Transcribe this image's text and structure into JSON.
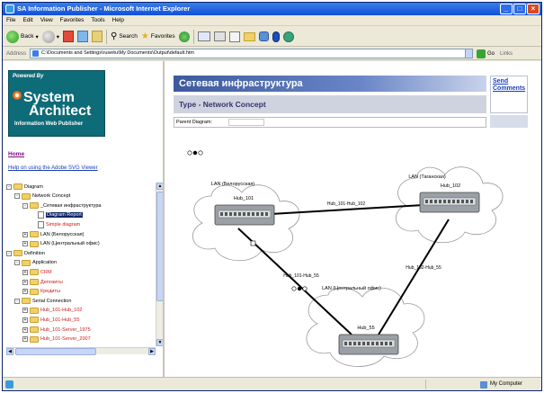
{
  "window": {
    "title": "SA Information Publisher - Microsoft Internet Explorer"
  },
  "menu": [
    "File",
    "Edit",
    "View",
    "Favorites",
    "Tools",
    "Help"
  ],
  "toolbar": {
    "back_label": "Back",
    "search_label": "Search",
    "favorites_label": "Favorites"
  },
  "address": {
    "label": "Address",
    "value": "C:\\Documents and Settings\\ruseitu\\My Documents\\Output\\default.htm",
    "go_label": "Go",
    "links_label": "Links"
  },
  "left": {
    "logo": {
      "powered": "Powered By",
      "line1": "System",
      "line2": "Architect",
      "line3": "Information Web Publisher"
    },
    "home_link": "Home",
    "help_link": "Help on using the Adobe SVG Viewer",
    "tree": [
      {
        "label": "Diagram",
        "level": 0,
        "kind": "folder",
        "exp": "-",
        "color": "normal"
      },
      {
        "label": "Network Concept",
        "level": 1,
        "kind": "folder",
        "exp": "-",
        "color": "normal"
      },
      {
        "label": "_Сетевая инфраструктура",
        "level": 2,
        "kind": "folder",
        "exp": "-",
        "color": "normal"
      },
      {
        "label": "Diagram Report",
        "level": 3,
        "kind": "doc",
        "exp": "",
        "color": "selected"
      },
      {
        "label": "Simple diagram",
        "level": 3,
        "kind": "doc",
        "exp": "",
        "color": "red"
      },
      {
        "label": "LAN (Белорусская)",
        "level": 2,
        "kind": "folder",
        "exp": "+",
        "color": "normal"
      },
      {
        "label": "LAN (Центральный офис)",
        "level": 2,
        "kind": "folder",
        "exp": "+",
        "color": "normal"
      },
      {
        "label": "Definition",
        "level": 0,
        "kind": "folder",
        "exp": "-",
        "color": "normal"
      },
      {
        "label": "Application",
        "level": 1,
        "kind": "folder",
        "exp": "-",
        "color": "normal"
      },
      {
        "label": "CRM",
        "level": 2,
        "kind": "folder",
        "exp": "+",
        "color": "red"
      },
      {
        "label": "Депозиты",
        "level": 2,
        "kind": "folder",
        "exp": "+",
        "color": "red"
      },
      {
        "label": "Кредиты",
        "level": 2,
        "kind": "folder",
        "exp": "+",
        "color": "red"
      },
      {
        "label": "Serial Connection",
        "level": 1,
        "kind": "folder",
        "exp": "-",
        "color": "normal"
      },
      {
        "label": "Hub_101-Hub_102",
        "level": 2,
        "kind": "folder",
        "exp": "+",
        "color": "red"
      },
      {
        "label": "Hub_101-Hub_55",
        "level": 2,
        "kind": "folder",
        "exp": "+",
        "color": "red"
      },
      {
        "label": "Hub_101-Server_1975",
        "level": 2,
        "kind": "folder",
        "exp": "+",
        "color": "red"
      },
      {
        "label": "Hub_101-Server_2007",
        "level": 2,
        "kind": "folder",
        "exp": "+",
        "color": "red"
      }
    ]
  },
  "right": {
    "title": "Сетевая инфраструктура",
    "type_line": "Type - Network Concept",
    "parent_label": "Parent Diagram:",
    "send_comments": "Send Comments"
  },
  "diagram": {
    "clouds": [
      {
        "name": "LAN (Белорусская)",
        "hub": "Hub_101"
      },
      {
        "name": "LAN (Таганская)",
        "hub": "Hub_102"
      },
      {
        "name": "LAN (Центральный офис)",
        "hub": "Hub_55"
      }
    ],
    "link_labels": {
      "a": "Hub_101-Hub_102",
      "b": "Hub_102-Hub_55",
      "c": "Hub_101-Hub_55"
    }
  },
  "status": {
    "zone": "My Computer"
  }
}
